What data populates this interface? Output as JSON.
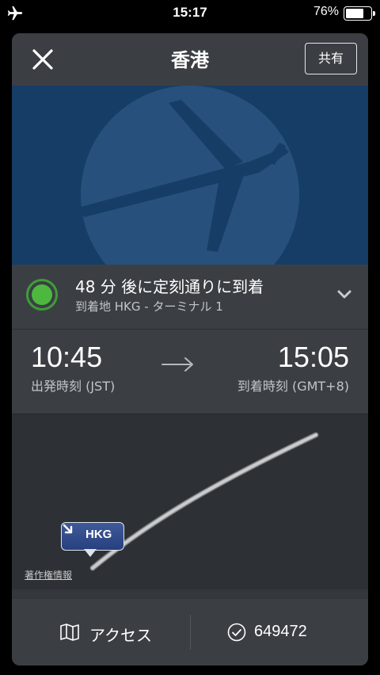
{
  "status_bar": {
    "time": "15:17",
    "battery_percent": "76%",
    "battery_level": 0.76,
    "airplane_icon": "airplane-icon"
  },
  "header": {
    "title": "香港",
    "close_icon": "close-icon",
    "share_label": "共有"
  },
  "flight_status": {
    "main": "48 分 後に定刻通りに到着",
    "sub": "到着地 HKG - ターミナル 1",
    "status_color": "#4cb93e",
    "expand_icon": "chevron-down-icon"
  },
  "times": {
    "departure_time": "10:45",
    "departure_label": "出発時刻 (JST)",
    "arrival_time": "15:05",
    "arrival_label": "到着時刻 (GMT+8)",
    "arrow_icon": "arrow-right-icon"
  },
  "map": {
    "pin_code": "HKG",
    "copyright": "著作権情報"
  },
  "footer": {
    "access_label": "アクセス",
    "confirmation_label": "649472"
  },
  "colors": {
    "card_bg": "#3b3f44",
    "hero_bg": "#163d65",
    "map_bg": "#2d3136"
  }
}
